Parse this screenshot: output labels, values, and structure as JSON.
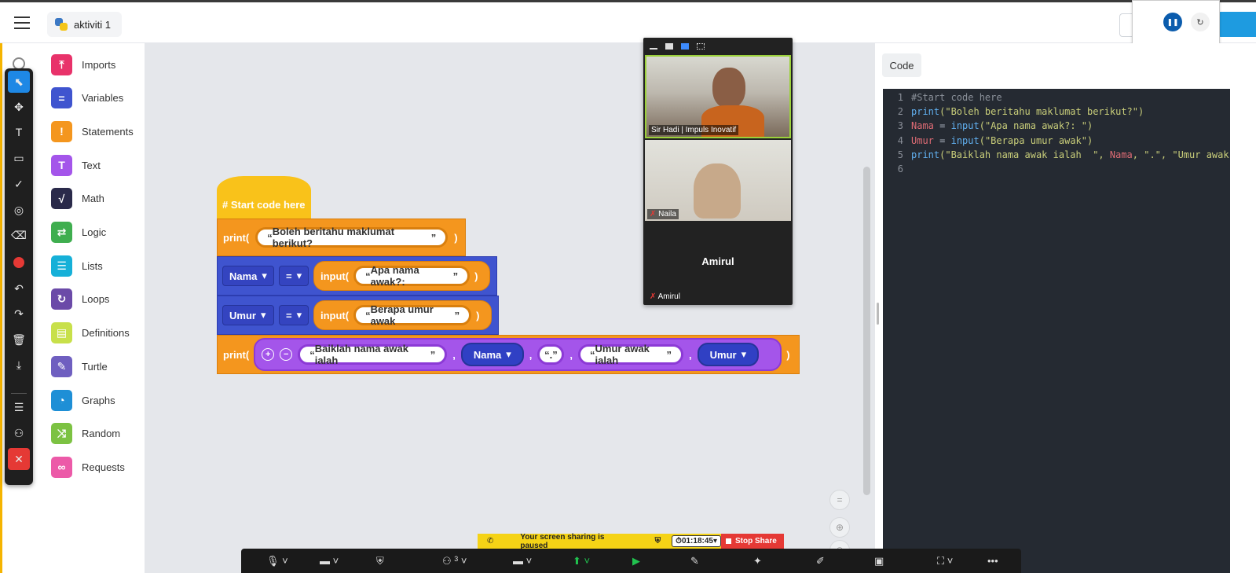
{
  "header": {
    "project_name": "aktiviti 1"
  },
  "annotation_tools": [
    {
      "icon": "pointer-icon",
      "glyph": "⬉",
      "active": true
    },
    {
      "icon": "move-icon",
      "glyph": "✥"
    },
    {
      "icon": "text-icon",
      "glyph": "T"
    },
    {
      "icon": "rectangle-icon",
      "glyph": "▭"
    },
    {
      "icon": "checkmark-icon",
      "glyph": "✓"
    },
    {
      "icon": "spotlight-icon",
      "glyph": "◎"
    },
    {
      "icon": "eraser-icon",
      "glyph": "⌫"
    },
    {
      "icon": "color-icon",
      "glyph": ""
    },
    {
      "icon": "undo-icon",
      "glyph": "↶"
    },
    {
      "icon": "redo-icon",
      "glyph": "↷"
    },
    {
      "icon": "trash-icon",
      "glyph": "🗑"
    },
    {
      "icon": "download-icon",
      "glyph": "⤓"
    },
    {
      "icon": "menu-icon",
      "glyph": "☰"
    },
    {
      "icon": "user-settings-icon",
      "glyph": "⚇"
    },
    {
      "icon": "close-icon",
      "glyph": "✕"
    }
  ],
  "categories": [
    {
      "label": "Imports",
      "color": "#e8326a",
      "glyph": "⤒"
    },
    {
      "label": "Variables",
      "color": "#3f54cf",
      "glyph": "="
    },
    {
      "label": "Statements",
      "color": "#f4961e",
      "glyph": "!"
    },
    {
      "label": "Text",
      "color": "#a455ea",
      "glyph": "T"
    },
    {
      "label": "Math",
      "color": "#2a2a4a",
      "glyph": "√"
    },
    {
      "label": "Logic",
      "color": "#3fae4f",
      "glyph": "⇄"
    },
    {
      "label": "Lists",
      "color": "#16b0d8",
      "glyph": "☰"
    },
    {
      "label": "Loops",
      "color": "#6b4aa8",
      "glyph": "↻"
    },
    {
      "label": "Definitions",
      "color": "#c8e04a",
      "glyph": "▤"
    },
    {
      "label": "Turtle",
      "color": "#6f5fc0",
      "glyph": "✎"
    },
    {
      "label": "Graphs",
      "color": "#1e8fd6",
      "glyph": "◔"
    },
    {
      "label": "Random",
      "color": "#7cc242",
      "glyph": "⤨"
    },
    {
      "label": "Requests",
      "color": "#ec5aa8",
      "glyph": "∞"
    }
  ],
  "blocks": {
    "hat": "# Start code here",
    "print_kw": "print(",
    "close_paren": ")",
    "input_kw": "input(",
    "equals": "=",
    "comma": ",",
    "print1_str": "Boleh beritahu maklumat berikut?",
    "assign1_var": "Nama",
    "assign1_str": "Apa nama awak?:",
    "assign2_var": "Umur",
    "assign2_str": "Berapa umur awak",
    "print3_str1": "Baiklah nama awak ialah",
    "print3_var1": "Nama",
    "print3_str2": ".",
    "print3_str3": "Umur awak ialah",
    "print3_var2": "Umur"
  },
  "video": {
    "participant1": "Sir Hadi | Impuls Inovatif",
    "participant2": "Naila",
    "participant3_name": "Amirul",
    "participant3_label": "Amirul"
  },
  "code_panel": {
    "tab_label": "Code",
    "lines": [
      {
        "n": "1",
        "parts": [
          {
            "t": "#Start code here",
            "c": "c-com"
          }
        ]
      },
      {
        "n": "2",
        "parts": [
          {
            "t": "print",
            "c": "c-fn"
          },
          {
            "t": "(\"Boleh beritahu maklumat berikut?\")",
            "c": "c-str"
          }
        ]
      },
      {
        "n": "3",
        "parts": [
          {
            "t": "Nama",
            "c": "c-var"
          },
          {
            "t": " = ",
            "c": "c-op"
          },
          {
            "t": "input",
            "c": "c-fn"
          },
          {
            "t": "(\"Apa nama awak?: \")",
            "c": "c-str"
          }
        ]
      },
      {
        "n": "4",
        "parts": [
          {
            "t": "Umur",
            "c": "c-var"
          },
          {
            "t": " = ",
            "c": "c-op"
          },
          {
            "t": "input",
            "c": "c-fn"
          },
          {
            "t": "(\"Berapa umur awak\")",
            "c": "c-str"
          }
        ]
      },
      {
        "n": "5",
        "parts": [
          {
            "t": "print",
            "c": "c-fn"
          },
          {
            "t": "(\"Baiklah nama awak ialah  \", ",
            "c": "c-str"
          },
          {
            "t": "Nama",
            "c": "c-var"
          },
          {
            "t": ", \".\", \"Umur awak",
            "c": "c-str"
          }
        ]
      },
      {
        "n": "6",
        "parts": []
      }
    ]
  },
  "share_bar": {
    "message": "Your screen sharing is paused",
    "timer": "01:18:45",
    "stop_label": "Stop Share"
  },
  "meeting_toolbar": {
    "participants_count": "3"
  }
}
